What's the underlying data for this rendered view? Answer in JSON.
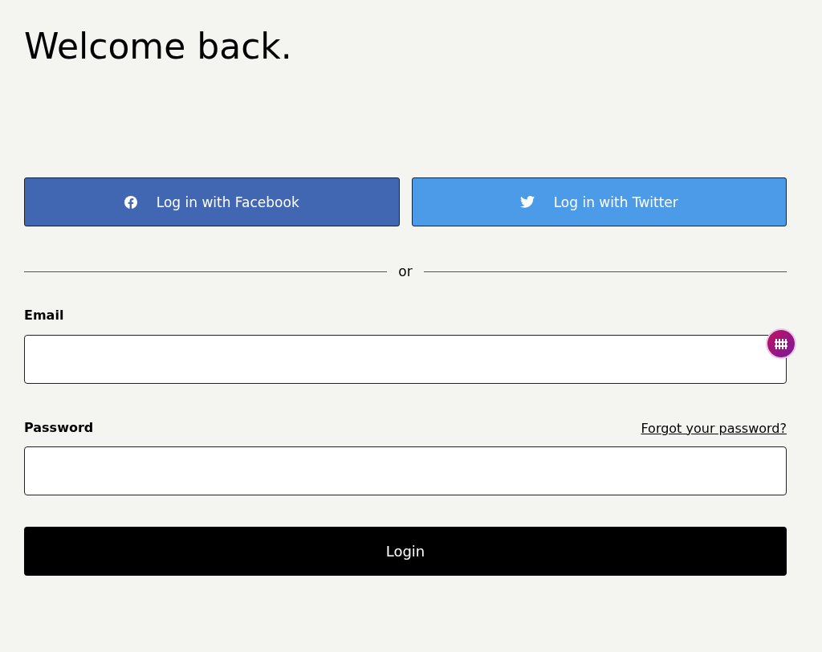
{
  "title": "Welcome back.",
  "social_buttons": [
    {
      "kind": "facebook",
      "label": "Log in with Facebook",
      "color": "#4267b2"
    },
    {
      "kind": "twitter",
      "label": "Log in with Twitter",
      "color": "#4c9be8"
    }
  ],
  "divider": "or",
  "email": {
    "label": "Email"
  },
  "password": {
    "label": "Password",
    "forgot_link": "Forgot your password?"
  },
  "login_button": "Login"
}
